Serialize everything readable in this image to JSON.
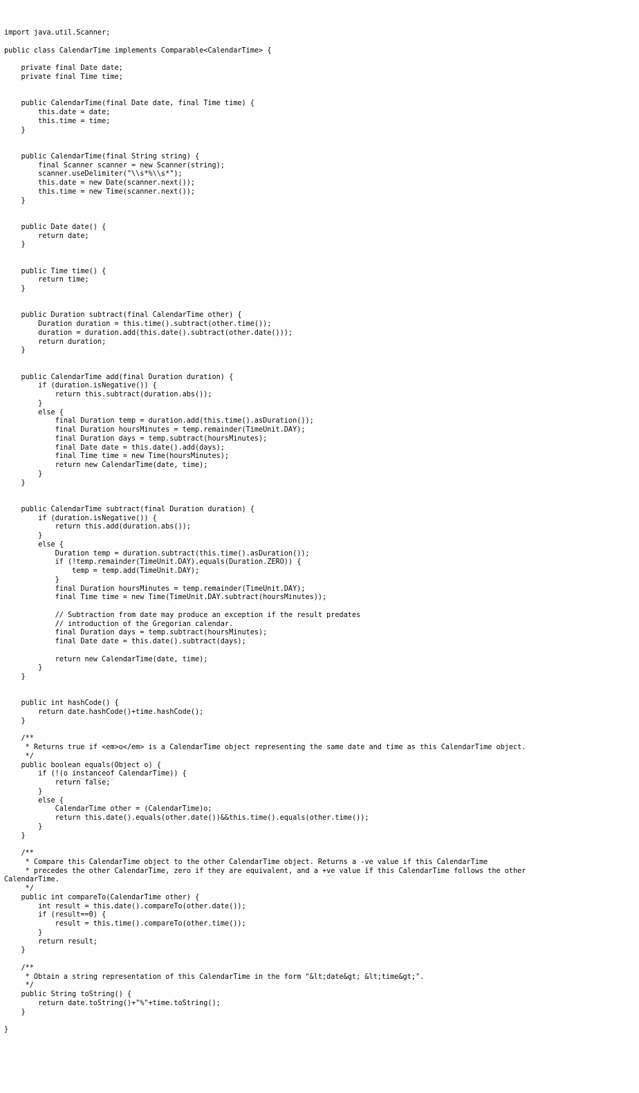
{
  "code": {
    "l01": "import java.util.Scanner;",
    "l02": "",
    "l03": "public class CalendarTime implements Comparable<CalendarTime> {",
    "l04": "",
    "l05": "    private final Date date;",
    "l06": "    private final Time time;",
    "l07": "",
    "l08": "",
    "l09": "    public CalendarTime(final Date date, final Time time) {",
    "l10": "        this.date = date;",
    "l11": "        this.time = time;",
    "l12": "    }",
    "l13": "",
    "l14": "",
    "l15": "    public CalendarTime(final String string) {",
    "l16": "        final Scanner scanner = new Scanner(string);",
    "l17": "        scanner.useDelimiter(\"\\\\s*%\\\\s*\");",
    "l18": "        this.date = new Date(scanner.next());",
    "l19": "        this.time = new Time(scanner.next());",
    "l20": "    }",
    "l21": "",
    "l22": "",
    "l23": "    public Date date() {",
    "l24": "        return date;",
    "l25": "    }",
    "l26": "",
    "l27": "",
    "l28": "    public Time time() {",
    "l29": "        return time;",
    "l30": "    }",
    "l31": "",
    "l32": "",
    "l33": "    public Duration subtract(final CalendarTime other) {",
    "l34": "        Duration duration = this.time().subtract(other.time());",
    "l35": "        duration = duration.add(this.date().subtract(other.date()));",
    "l36": "        return duration;",
    "l37": "    }",
    "l38": "",
    "l39": "",
    "l40": "    public CalendarTime add(final Duration duration) {",
    "l41": "        if (duration.isNegative()) {",
    "l42": "            return this.subtract(duration.abs());",
    "l43": "        }",
    "l44": "        else {",
    "l45": "            final Duration temp = duration.add(this.time().asDuration());",
    "l46": "            final Duration hoursMinutes = temp.remainder(TimeUnit.DAY);",
    "l47": "            final Duration days = temp.subtract(hoursMinutes);",
    "l48": "            final Date date = this.date().add(days);",
    "l49": "            final Time time = new Time(hoursMinutes);",
    "l50": "            return new CalendarTime(date, time);",
    "l51": "        }",
    "l52": "    }",
    "l53": "",
    "l54": "",
    "l55": "    public CalendarTime subtract(final Duration duration) {",
    "l56": "        if (duration.isNegative()) {",
    "l57": "            return this.add(duration.abs());",
    "l58": "        }",
    "l59": "        else {",
    "l60": "            Duration temp = duration.subtract(this.time().asDuration());",
    "l61": "            if (!temp.remainder(TimeUnit.DAY).equals(Duration.ZERO)) {",
    "l62": "                temp = temp.add(TimeUnit.DAY);",
    "l63": "            }",
    "l64": "            final Duration hoursMinutes = temp.remainder(TimeUnit.DAY);",
    "l65": "            final Time time = new Time(TimeUnit.DAY.subtract(hoursMinutes));",
    "l66": "",
    "l67": "            // Subtraction from date may produce an exception if the result predates",
    "l68": "            // introduction of the Gregorian calendar.",
    "l69": "            final Duration days = temp.subtract(hoursMinutes);",
    "l70": "            final Date date = this.date().subtract(days);",
    "l71": "",
    "l72": "            return new CalendarTime(date, time);",
    "l73": "        }",
    "l74": "    }",
    "l75": "",
    "l76": "",
    "l77": "    public int hashCode() {",
    "l78": "        return date.hashCode()+time.hashCode();",
    "l79": "    }",
    "l80": "",
    "l81": "    /**",
    "l82": "     * Returns true if <em>o</em> is a CalendarTime object representing the same date and time as this CalendarTime object.",
    "l83": "     */",
    "l84": "    public boolean equals(Object o) {",
    "l85a": "        if (!(o ",
    "l85_instanceof": "instanceof",
    "l85b": " CalendarTime)) {",
    "l86": "            return false;",
    "l87": "        }",
    "l88": "        else {",
    "l89": "            CalendarTime other = (CalendarTime)o;",
    "l90": "            return this.date().equals(other.date())&&this.time().equals(other.time());",
    "l91": "        }",
    "l92": "    }",
    "l93": "",
    "l94": "    /**",
    "l95a": "     * Compare this CalendarTime object to the other CalendarTime object. Returns a -",
    "l95_ve": "ve",
    "l95b": " value if this CalendarTime",
    "l96a": "     * precedes the other CalendarTime, zero if they are equivalent, and a +",
    "l96_ve": "ve",
    "l96b": " value if this CalendarTime follows the other",
    "l97": "CalendarTime.",
    "l98": "     */",
    "l99": "    public int compareTo(CalendarTime other) {",
    "l100": "        int result = this.date().compareTo(other.date());",
    "l101": "        if (result==0) {",
    "l102": "            result = this.time().compareTo(other.time());",
    "l103": "        }",
    "l104": "        return result;",
    "l105": "    }",
    "l106": "",
    "l107": "    /**",
    "l108": "     * Obtain a string representation of this CalendarTime in the form \"&lt;date&gt; &lt;time&gt;\".",
    "l109": "     */",
    "l110": "    public String toString() {",
    "l111": "        return date.toString()+\"%\"+time.toString();",
    "l112": "    }",
    "l113": "",
    "l114": "}"
  }
}
